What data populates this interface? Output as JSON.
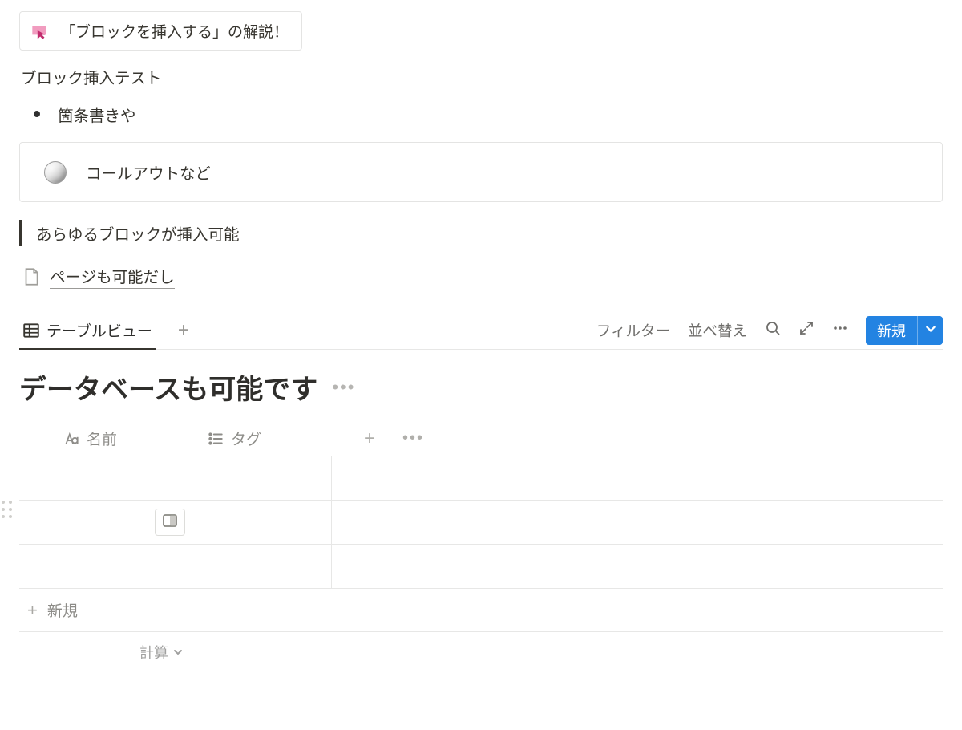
{
  "page_link": {
    "text": "「ブロックを挿入する」の解説！"
  },
  "paragraph": "ブロック挿入テスト",
  "bullet": "箇条書きや",
  "callout": "コールアウトなど",
  "quote": "あらゆるブロックが挿入可能",
  "subpage": "ページも可能だし",
  "database": {
    "tab_label": "テーブルビュー",
    "toolbar": {
      "filter": "フィルター",
      "sort": "並べ替え",
      "new": "新規"
    },
    "title": "データベースも可能です",
    "columns": {
      "name": "名前",
      "tag": "タグ"
    },
    "new_row": "新規",
    "calc": "計算"
  }
}
